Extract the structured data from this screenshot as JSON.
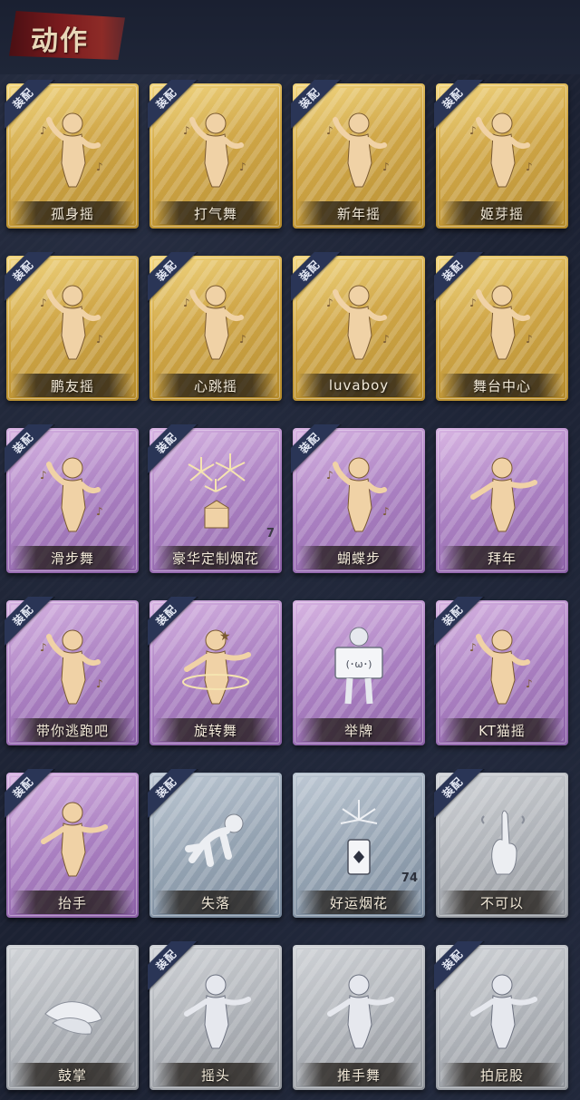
{
  "header": {
    "title": "动作"
  },
  "equip_label": "装配",
  "cards": [
    {
      "name": "孤身摇",
      "tier": "gold",
      "equipped": true,
      "count": "",
      "icon": "dance-figure-icon"
    },
    {
      "name": "打气舞",
      "tier": "gold",
      "equipped": true,
      "count": "",
      "icon": "dance-figure-icon"
    },
    {
      "name": "新年摇",
      "tier": "gold",
      "equipped": true,
      "count": "",
      "icon": "dance-figure-icon"
    },
    {
      "name": "姬芽摇",
      "tier": "gold",
      "equipped": true,
      "count": "",
      "icon": "dance-figure-icon"
    },
    {
      "name": "鹏友摇",
      "tier": "gold",
      "equipped": true,
      "count": "",
      "icon": "dance-figure-icon"
    },
    {
      "name": "心跳摇",
      "tier": "gold",
      "equipped": true,
      "count": "",
      "icon": "dance-figure-icon"
    },
    {
      "name": "luvaboy",
      "tier": "gold",
      "equipped": true,
      "count": "",
      "icon": "dance-figure-icon"
    },
    {
      "name": "舞台中心",
      "tier": "gold",
      "equipped": true,
      "count": "",
      "icon": "dance-figure-icon"
    },
    {
      "name": "滑步舞",
      "tier": "purple",
      "equipped": true,
      "count": "",
      "icon": "dance-figure-icon"
    },
    {
      "name": "豪华定制烟花",
      "tier": "purple",
      "equipped": true,
      "count": "7",
      "icon": "fireworks-icon"
    },
    {
      "name": "蝴蝶步",
      "tier": "purple",
      "equipped": true,
      "count": "",
      "icon": "dance-figure-icon"
    },
    {
      "name": "拜年",
      "tier": "purple",
      "equipped": false,
      "count": "",
      "icon": "greeting-figure-icon"
    },
    {
      "name": "带你逃跑吧",
      "tier": "purple",
      "equipped": true,
      "count": "",
      "icon": "dance-figure-icon"
    },
    {
      "name": "旋转舞",
      "tier": "purple",
      "equipped": true,
      "count": "",
      "icon": "spin-figure-icon"
    },
    {
      "name": "举牌",
      "tier": "purple",
      "equipped": false,
      "count": "",
      "icon": "sign-board-icon"
    },
    {
      "name": "KT猫摇",
      "tier": "purple",
      "equipped": true,
      "count": "",
      "icon": "dance-figure-icon"
    },
    {
      "name": "抬手",
      "tier": "purple",
      "equipped": true,
      "count": "",
      "icon": "raise-hand-figure-icon"
    },
    {
      "name": "失落",
      "tier": "blue",
      "equipped": true,
      "count": "",
      "icon": "crawl-figure-icon"
    },
    {
      "name": "好运烟花",
      "tier": "blue",
      "equipped": false,
      "count": "74",
      "icon": "firework-can-icon"
    },
    {
      "name": "不可以",
      "tier": "gray",
      "equipped": true,
      "count": "",
      "icon": "finger-wag-icon"
    },
    {
      "name": "鼓掌",
      "tier": "gray",
      "equipped": false,
      "count": "",
      "icon": "clap-hands-icon"
    },
    {
      "name": "摇头",
      "tier": "gray",
      "equipped": true,
      "count": "",
      "icon": "head-shake-figure-icon"
    },
    {
      "name": "推手舞",
      "tier": "gray",
      "equipped": false,
      "count": "",
      "icon": "push-hands-figure-icon"
    },
    {
      "name": "拍屁股",
      "tier": "gray",
      "equipped": true,
      "count": "",
      "icon": "pat-figure-icon"
    }
  ],
  "colors": {
    "background": "#1c2233",
    "title_banner": "#7a1b1e",
    "gold": "#cda23f",
    "purple": "#a77bbf",
    "blue": "#8f9eae",
    "gray": "#a9adb3",
    "badge": "#2a3556"
  }
}
